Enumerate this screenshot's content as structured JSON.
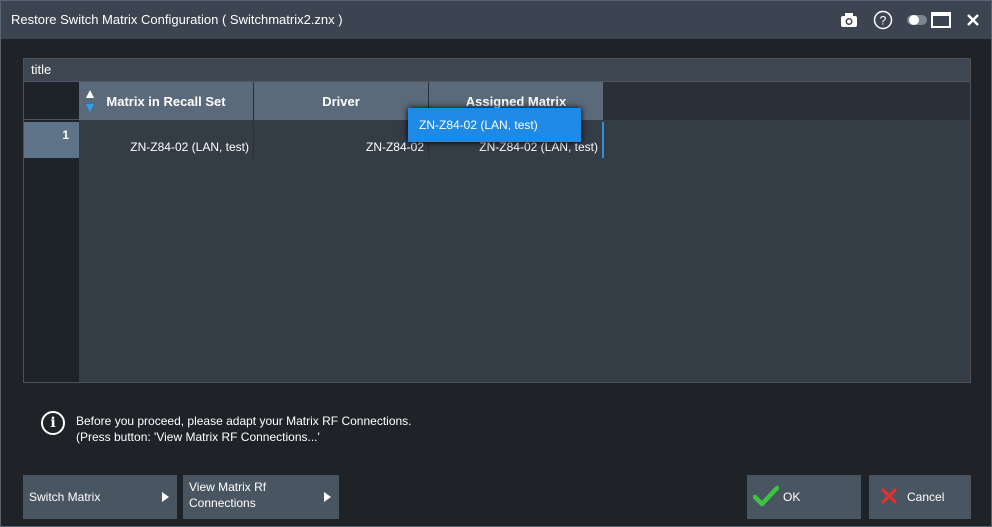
{
  "window": {
    "title": "Restore Switch Matrix Configuration  ( Switchmatrix2.znx )",
    "icons": [
      "camera-icon",
      "help-icon",
      "toggle-icon",
      "maximize-icon",
      "close-icon"
    ]
  },
  "panel": {
    "title": "title"
  },
  "table": {
    "columns": [
      "Matrix in Recall Set",
      "Driver",
      "Assigned Matrix"
    ],
    "rows": [
      {
        "index": "1",
        "matrix": "ZN-Z84-02 (LAN, test)",
        "driver": "ZN-Z84-02",
        "assigned": "ZN-Z84-02 (LAN, test)"
      }
    ],
    "dropdown_option": "ZN-Z84-02 (LAN, test)"
  },
  "info": {
    "line1": "Before you proceed, please adapt your Matrix RF Connections.",
    "line2": "(Press button: 'View Matrix RF Connections...'"
  },
  "buttons": {
    "switch_matrix": "Switch Matrix",
    "view_line1": "View Matrix Rf",
    "view_line2": "Connections",
    "ok": "OK",
    "cancel": "Cancel"
  },
  "colors": {
    "accent": "#1e8ae6",
    "ok": "#3ec43e",
    "cancel": "#e03030"
  }
}
